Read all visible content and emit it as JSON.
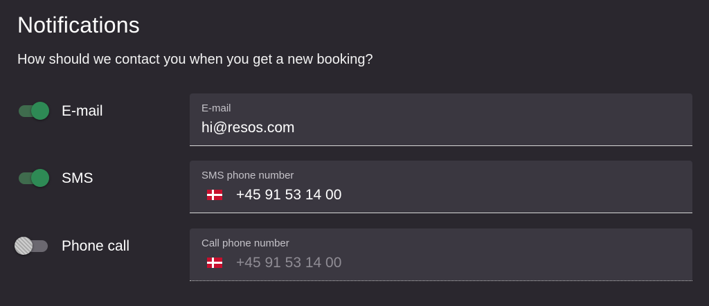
{
  "header": {
    "title": "Notifications",
    "subtitle": "How should we contact you when you get a new booking?"
  },
  "colors": {
    "background": "#2a272e",
    "field_background": "#3a3740",
    "toggle_on": "#2e8a55",
    "toggle_off": "#6b6870"
  },
  "channels": [
    {
      "label": "E-mail",
      "enabled": true,
      "field_label": "E-mail",
      "field_value": "hi@resos.com"
    },
    {
      "label": "SMS",
      "enabled": true,
      "field_label": "SMS phone number",
      "field_value": "+45 91 53 14 00",
      "flag": "denmark-flag-icon"
    },
    {
      "label": "Phone call",
      "enabled": false,
      "field_label": "Call phone number",
      "field_value": "+45 91 53 14 00",
      "flag": "denmark-flag-icon"
    }
  ]
}
